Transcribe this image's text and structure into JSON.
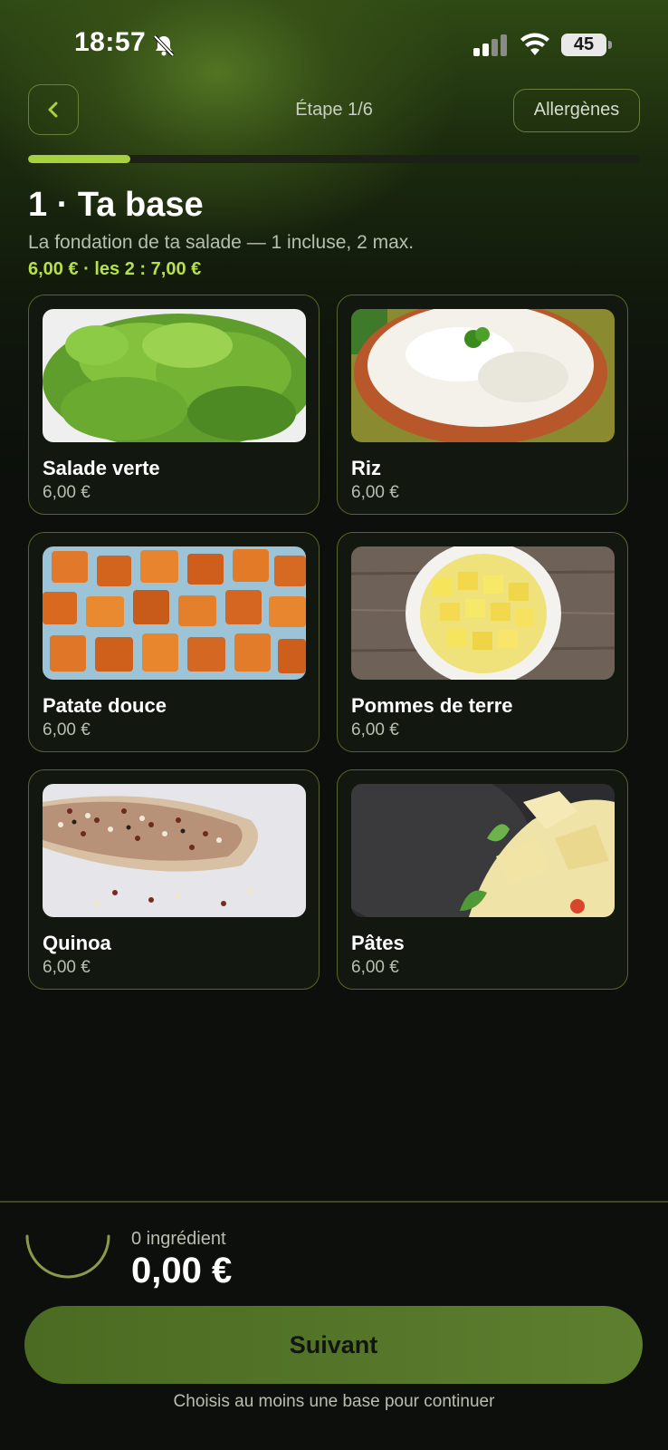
{
  "status_bar": {
    "time": "18:57",
    "battery": "45",
    "icons": [
      "bell-slash-icon",
      "signal-icon",
      "wifi-icon",
      "battery-icon"
    ]
  },
  "header": {
    "back_icon": "chevron-left-icon",
    "step_label": "Étape 1/6",
    "allergens_label": "Allergènes",
    "progress": 0.1667
  },
  "section": {
    "title": "1 · Ta base",
    "subtitle": "La fondation de ta salade — 1 incluse, 2 max.",
    "price_info": "6,00 € · les 2 : 7,00 €"
  },
  "items": [
    {
      "name": "Salade verte",
      "price": "6,00 €"
    },
    {
      "name": "Riz",
      "price": "6,00 €"
    },
    {
      "name": "Patate douce",
      "price": "6,00 €"
    },
    {
      "name": "Pommes de terre",
      "price": "6,00 €"
    },
    {
      "name": "Quinoa",
      "price": "6,00 €"
    },
    {
      "name": "Pâtes",
      "price": "6,00 €"
    }
  ],
  "footer": {
    "ingredient_count": "0 ingrédient",
    "total": "0,00 €",
    "next_label": "Suivant",
    "hint": "Choisis au moins une base pour continuer"
  },
  "colors": {
    "accent": "#a7d13f",
    "price_accent": "#b8e04a",
    "card_border": "#56652e",
    "button": "#56772a",
    "background": "#0c0f0b"
  }
}
